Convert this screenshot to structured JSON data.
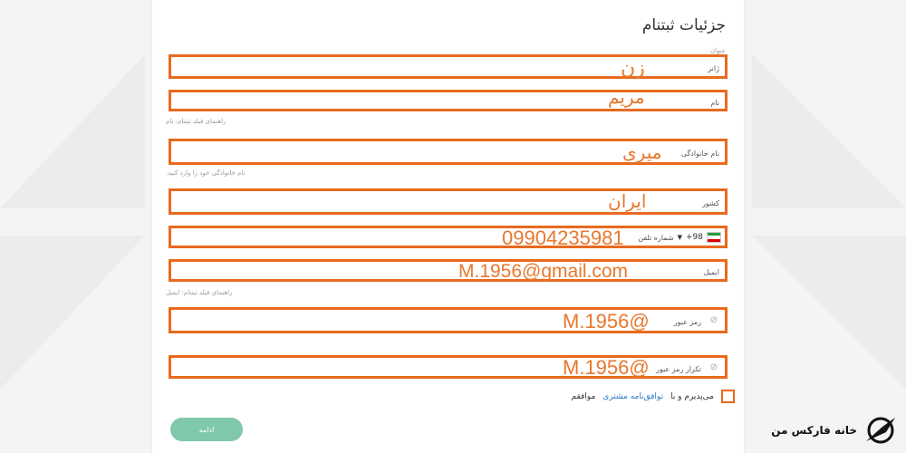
{
  "page": {
    "title": "جزئیات ثبتنام",
    "top_small": "عنوان"
  },
  "fields": {
    "gender": {
      "label": "ژانر",
      "value": "زن"
    },
    "first_name": {
      "label": "نام",
      "value": "مریم",
      "hint": "راهنمای فیلد ثبتنام: نام"
    },
    "last_name": {
      "label": "نام خانوادگی",
      "value": "میری",
      "hint": "نام خانوادگی خود را وارد کنید."
    },
    "country": {
      "label": "کشور",
      "value": "ایران"
    },
    "phone": {
      "label": "شماره تلفن",
      "code": "+98",
      "value": "09904235981"
    },
    "email": {
      "label": "ایمیل",
      "value": "M.1956@gmail.com",
      "hint": "راهنمای فیلد ثبتنام: ایمیل"
    },
    "password": {
      "label": "رمز عبور",
      "value": "M.1956@"
    },
    "password_confirm": {
      "label": "تکرار رمز عبور",
      "value": "M.1956@"
    }
  },
  "agree": {
    "prefix": "می‌پذیرم و با",
    "link": "توافق‌نامه مشتری",
    "suffix": "موافقم"
  },
  "continue_label": "ادامه",
  "brand": {
    "name": "خانه فارکس من",
    "icon": "compass-logo-icon"
  },
  "colors": {
    "highlight": "#e86a1f",
    "value_text": "#e8782c",
    "button": "#7fc8a9"
  }
}
